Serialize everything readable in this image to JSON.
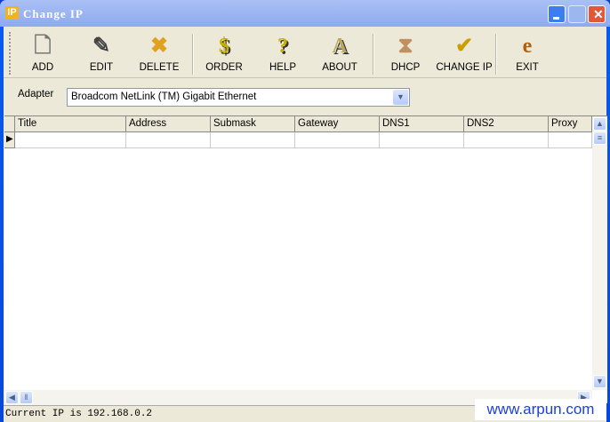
{
  "window": {
    "title": "Change  IP",
    "app_icon": "IP"
  },
  "toolbar": [
    {
      "label": "ADD",
      "icon": "add-doc-icon"
    },
    {
      "label": "EDIT",
      "icon": "edit-doc-icon"
    },
    {
      "label": "DELETE",
      "icon": "delete-doc-icon"
    },
    {
      "label": "ORDER",
      "icon": "dollar-icon"
    },
    {
      "label": "HELP",
      "icon": "question-icon"
    },
    {
      "label": "ABOUT",
      "icon": "letter-a-icon"
    },
    {
      "label": "DHCP",
      "icon": "dhcp-icon"
    },
    {
      "label": "CHANGE IP",
      "icon": "check-doc-icon"
    },
    {
      "label": "EXIT",
      "icon": "exit-icon"
    }
  ],
  "adapter": {
    "label": "Adapter",
    "value": "Broadcom NetLink (TM) Gigabit Ethernet"
  },
  "grid": {
    "columns": [
      "Title",
      "Address",
      "Submask",
      "Gateway",
      "DNS1",
      "DNS2",
      "Proxy"
    ]
  },
  "status": "Current IP is 192.168.0.2",
  "watermark": "www.arpun.com"
}
